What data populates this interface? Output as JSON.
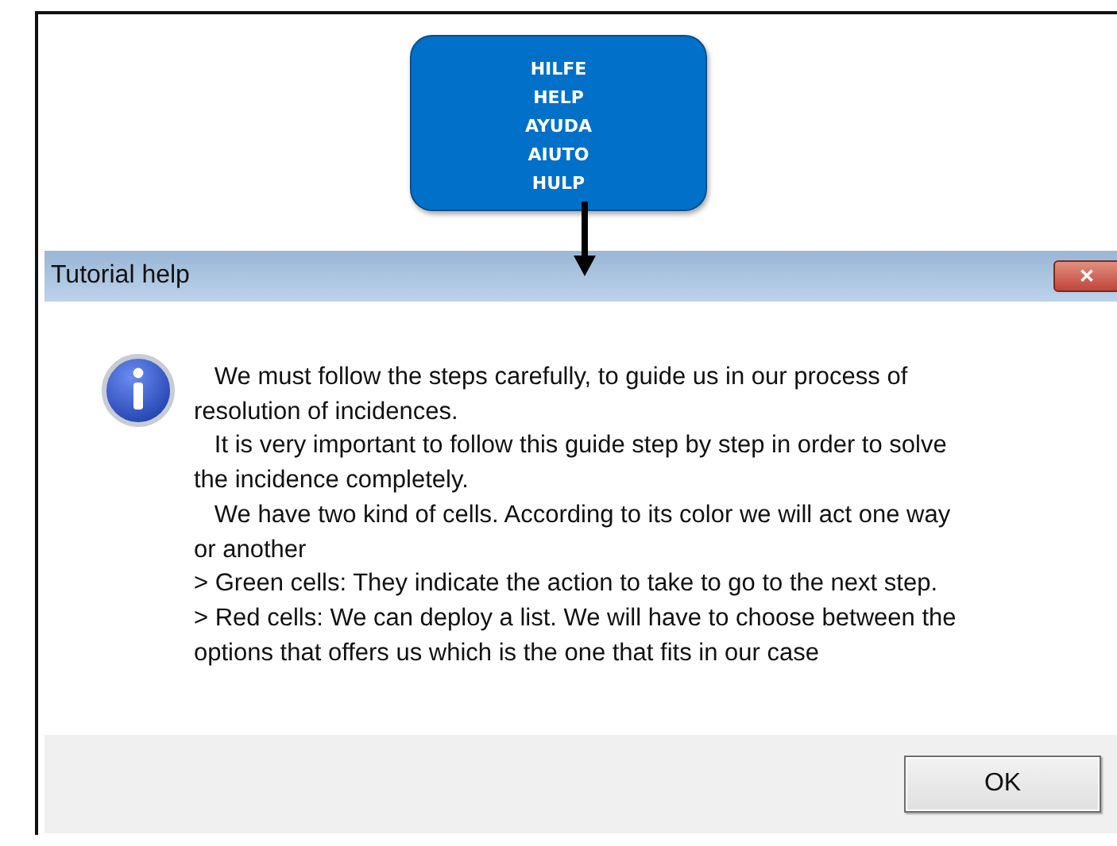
{
  "help_button": {
    "labels": [
      "HILFE",
      "HELP",
      "AYUDA",
      "AIUTO",
      "HULP"
    ]
  },
  "dialog": {
    "title": "Tutorial help",
    "close": "✕",
    "message_lines": [
      "   We must follow the steps carefully, to guide us in our process of",
      "resolution of incidences.",
      "   It is very important to follow this guide step by step in order to solve",
      "the incidence completely.",
      "   We have two kind of cells. According to its color we will act one way",
      "or another",
      "> Green cells: They indicate the action to take to go to the next step.",
      "> Red cells: We can deploy a list. We will have to choose between the",
      "options that offers us which is the one that fits in our case"
    ],
    "buttons": [
      "OK"
    ]
  }
}
